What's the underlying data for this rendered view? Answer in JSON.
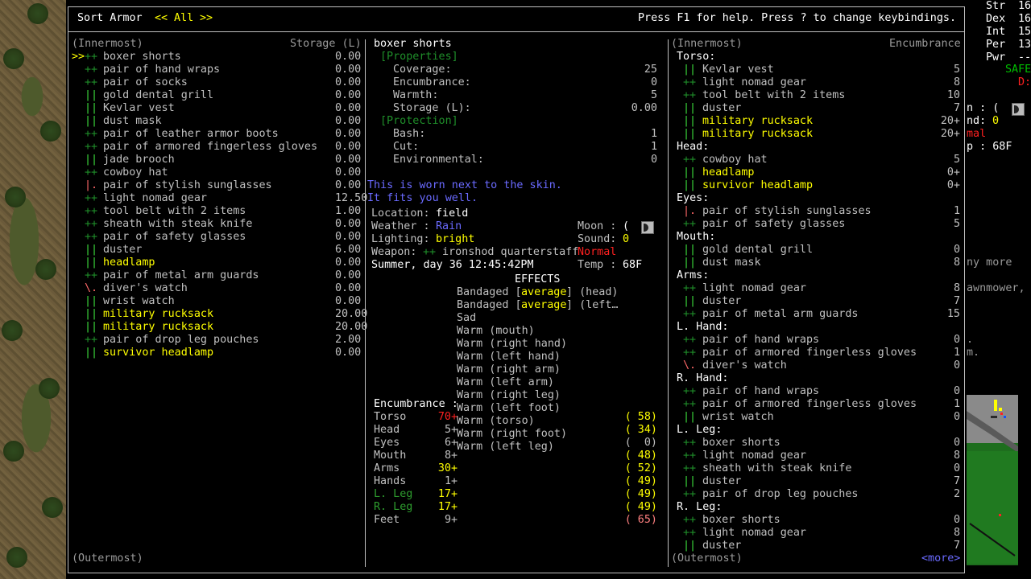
{
  "header": {
    "sort_label": "Sort Armor",
    "filter_left": "<<",
    "filter_value": "All",
    "filter_right": ">>",
    "help": "Press F1 for help. Press ? to change keybindings."
  },
  "left": {
    "col_title": "(Innermost)",
    "col_storage": "Storage (L)",
    "footer": "(Outermost)",
    "items": [
      {
        "mark": ">>",
        "sym": "++",
        "name": "boxer shorts",
        "val": "0.00"
      },
      {
        "mark": "",
        "sym": "++",
        "name": "pair of hand wraps",
        "val": "0.00"
      },
      {
        "mark": "",
        "sym": "++",
        "name": "pair of socks",
        "val": "0.00"
      },
      {
        "mark": "",
        "sym": "||",
        "name": "gold dental grill",
        "val": "0.00"
      },
      {
        "mark": "",
        "sym": "||",
        "name": "Kevlar vest",
        "val": "0.00"
      },
      {
        "mark": "",
        "sym": "||",
        "name": "dust mask",
        "val": "0.00"
      },
      {
        "mark": "",
        "sym": "++",
        "name": "pair of leather armor boots",
        "val": "0.00"
      },
      {
        "mark": "",
        "sym": "++",
        "name": "pair of armored fingerless gloves",
        "val": "0.00"
      },
      {
        "mark": "",
        "sym": "||",
        "name": "jade brooch",
        "val": "0.00"
      },
      {
        "mark": "",
        "sym": "++",
        "name": "cowboy hat",
        "val": "0.00"
      },
      {
        "mark": "",
        "sym": "|.",
        "name": "pair of stylish sunglasses",
        "val": "0.00"
      },
      {
        "mark": "",
        "sym": "++",
        "name": "light nomad gear",
        "val": "12.50"
      },
      {
        "mark": "",
        "sym": "++",
        "name": "tool belt with 2 items",
        "val": "1.00"
      },
      {
        "mark": "",
        "sym": "++",
        "name": "sheath with steak knife",
        "val": "0.00"
      },
      {
        "mark": "",
        "sym": "++",
        "name": "pair of safety glasses",
        "val": "0.00"
      },
      {
        "mark": "",
        "sym": "||",
        "name": "duster",
        "val": "6.00"
      },
      {
        "mark": "",
        "sym": "||",
        "name": "headlamp",
        "val": "0.00",
        "hl": true
      },
      {
        "mark": "",
        "sym": "++",
        "name": "pair of metal arm guards",
        "val": "0.00"
      },
      {
        "mark": "",
        "sym": "\\.",
        "name": "diver's watch",
        "val": "0.00"
      },
      {
        "mark": "",
        "sym": "||",
        "name": "wrist watch",
        "val": "0.00"
      },
      {
        "mark": "",
        "sym": "||",
        "name": "military rucksack",
        "val": "20.00",
        "hl": true
      },
      {
        "mark": "",
        "sym": "||",
        "name": "military rucksack",
        "val": "20.00",
        "hl": true
      },
      {
        "mark": "",
        "sym": "++",
        "name": "pair of drop leg pouches",
        "val": "2.00"
      },
      {
        "mark": "",
        "sym": "||",
        "name": "survivor headlamp",
        "val": "0.00",
        "hl": true
      }
    ]
  },
  "middle": {
    "item_title": "boxer shorts",
    "properties_header": "[Properties]",
    "properties": [
      {
        "label": "Coverage:",
        "value": "25"
      },
      {
        "label": "Encumbrance:",
        "value": "0"
      },
      {
        "label": "Warmth:",
        "value": "5"
      },
      {
        "label": "Storage (L):",
        "value": "0.00"
      }
    ],
    "protection_header": "[Protection]",
    "protection": [
      {
        "label": "Bash:",
        "value": "1"
      },
      {
        "label": "Cut:",
        "value": "1"
      },
      {
        "label": "Environmental:",
        "value": "0"
      }
    ],
    "note1": "This is worn next to the skin.",
    "note2": "It fits you well.",
    "status": {
      "location_label": "Location:",
      "location": "field",
      "weather_label": "Weather :",
      "weather": "Rain",
      "moon_label": "Moon :",
      "moon_icon": "moon-phase-icon",
      "lighting_label": "Lighting:",
      "lighting": "bright",
      "sound_label": "Sound:",
      "sound": "0",
      "weapon_label": "Weapon:",
      "weapon_sym": "++",
      "weapon": "ironshod quarterstaff",
      "weapon_state": "Normal",
      "date": "Summer, day 36 12:45:42PM",
      "temp_label": "Temp :",
      "temp": "68F"
    },
    "effects_header": "EFFECTS",
    "effects": [
      {
        "pre": "Bandaged [",
        "mid": "average",
        "post": "] (head)"
      },
      {
        "pre": "Bandaged [",
        "mid": "average",
        "post": "] (left…"
      },
      {
        "pre": "Sad",
        "mid": "",
        "post": ""
      },
      {
        "pre": "Warm (mouth)",
        "mid": "",
        "post": ""
      },
      {
        "pre": "Warm (right hand)",
        "mid": "",
        "post": ""
      },
      {
        "pre": "Warm (left hand)",
        "mid": "",
        "post": ""
      },
      {
        "pre": "Warm (right arm)",
        "mid": "",
        "post": ""
      },
      {
        "pre": "Warm (left arm)",
        "mid": "",
        "post": ""
      },
      {
        "pre": "Warm (right leg)",
        "mid": "",
        "post": ""
      },
      {
        "pre": "Warm (left foot)",
        "mid": "",
        "post": ""
      },
      {
        "pre": "Warm (torso)",
        "mid": "",
        "post": ""
      },
      {
        "pre": "Warm (right foot)",
        "mid": "",
        "post": ""
      },
      {
        "pre": "Warm (left leg)",
        "mid": "",
        "post": ""
      }
    ],
    "encumbrance_header": "Encumbrance :",
    "encumbrance": [
      {
        "part": "Torso",
        "a": "70",
        "b": "+16",
        "warmth": "( 58)",
        "ca": "r",
        "cb": "r",
        "cw": "y"
      },
      {
        "part": "Head",
        "a": "5",
        "b": "+2",
        "warmth": "( 34)",
        "ca": "g",
        "cb": "g",
        "cw": "y"
      },
      {
        "part": "Eyes",
        "a": "6",
        "b": "+0",
        "warmth": "(  0)",
        "ca": "g",
        "cb": "g",
        "cw": "g"
      },
      {
        "part": "Mouth",
        "a": "8",
        "b": "+0",
        "warmth": "( 48)",
        "ca": "g",
        "cb": "g",
        "cw": "y"
      },
      {
        "part": "Arms",
        "a": "30",
        "b": "+0",
        "warmth": "( 52)",
        "ca": "y",
        "cb": "y",
        "cw": "y"
      },
      {
        "part": "Hands",
        "a": "1",
        "b": "+0",
        "warmth": "( 49)",
        "ca": "g",
        "cb": "g",
        "cw": "y"
      },
      {
        "part": "L. Leg",
        "a": "17",
        "b": "+0",
        "warmth": "( 49)",
        "ca": "y",
        "cb": "y",
        "cw": "y",
        "pc": "tg"
      },
      {
        "part": "R. Leg",
        "a": "17",
        "b": "+0",
        "warmth": "( 49)",
        "ca": "y",
        "cb": "y",
        "cw": "y",
        "pc": "tg"
      },
      {
        "part": "Feet",
        "a": "9",
        "b": "+0",
        "warmth": "( 65)",
        "ca": "g",
        "cb": "g",
        "cw": "pk"
      }
    ]
  },
  "right": {
    "col_title": "(Innermost)",
    "col_enc": "Encumbrance",
    "footer": "(Outermost)",
    "more": "<more>",
    "rows": [
      {
        "t": "h",
        "name": "Torso:"
      },
      {
        "t": "i",
        "sym": "||",
        "name": "Kevlar vest",
        "val": "5"
      },
      {
        "t": "i",
        "sym": "++",
        "name": "light nomad gear",
        "val": "8"
      },
      {
        "t": "i",
        "sym": "++",
        "name": "tool belt with 2 items",
        "val": "10"
      },
      {
        "t": "i",
        "sym": "||",
        "name": "duster",
        "val": "7"
      },
      {
        "t": "i",
        "sym": "||",
        "name": "military rucksack",
        "val": "20+",
        "hl": true
      },
      {
        "t": "i",
        "sym": "||",
        "name": "military rucksack",
        "val": "20+",
        "hl": true
      },
      {
        "t": "h",
        "name": "Head:"
      },
      {
        "t": "i",
        "sym": "++",
        "name": "cowboy hat",
        "val": "5"
      },
      {
        "t": "i",
        "sym": "||",
        "name": "headlamp",
        "val": "0+",
        "hl": true
      },
      {
        "t": "i",
        "sym": "||",
        "name": "survivor headlamp",
        "val": "0+",
        "hl": true
      },
      {
        "t": "h",
        "name": "Eyes:"
      },
      {
        "t": "i",
        "sym": "|.",
        "name": "pair of stylish sunglasses",
        "val": "1"
      },
      {
        "t": "i",
        "sym": "++",
        "name": "pair of safety glasses",
        "val": "5"
      },
      {
        "t": "h",
        "name": "Mouth:"
      },
      {
        "t": "i",
        "sym": "||",
        "name": "gold dental grill",
        "val": "0"
      },
      {
        "t": "i",
        "sym": "||",
        "name": "dust mask",
        "val": "8"
      },
      {
        "t": "h",
        "name": "Arms:"
      },
      {
        "t": "i",
        "sym": "++",
        "name": "light nomad gear",
        "val": "8"
      },
      {
        "t": "i",
        "sym": "||",
        "name": "duster",
        "val": "7"
      },
      {
        "t": "i",
        "sym": "++",
        "name": "pair of metal arm guards",
        "val": "15"
      },
      {
        "t": "h",
        "name": "L. Hand:"
      },
      {
        "t": "i",
        "sym": "++",
        "name": "pair of hand wraps",
        "val": "0"
      },
      {
        "t": "i",
        "sym": "++",
        "name": "pair of armored fingerless gloves",
        "val": "1"
      },
      {
        "t": "i",
        "sym": "\\.",
        "name": "diver's watch",
        "val": "0"
      },
      {
        "t": "h",
        "name": "R. Hand:"
      },
      {
        "t": "i",
        "sym": "++",
        "name": "pair of hand wraps",
        "val": "0"
      },
      {
        "t": "i",
        "sym": "++",
        "name": "pair of armored fingerless gloves",
        "val": "1"
      },
      {
        "t": "i",
        "sym": "||",
        "name": "wrist watch",
        "val": "0"
      },
      {
        "t": "h",
        "name": "L. Leg:"
      },
      {
        "t": "i",
        "sym": "++",
        "name": "boxer shorts",
        "val": "0"
      },
      {
        "t": "i",
        "sym": "++",
        "name": "light nomad gear",
        "val": "8"
      },
      {
        "t": "i",
        "sym": "++",
        "name": "sheath with steak knife",
        "val": "0"
      },
      {
        "t": "i",
        "sym": "||",
        "name": "duster",
        "val": "7"
      },
      {
        "t": "i",
        "sym": "++",
        "name": "pair of drop leg pouches",
        "val": "2"
      },
      {
        "t": "h",
        "name": "R. Leg:"
      },
      {
        "t": "i",
        "sym": "++",
        "name": "boxer shorts",
        "val": "0"
      },
      {
        "t": "i",
        "sym": "++",
        "name": "light nomad gear",
        "val": "8"
      },
      {
        "t": "i",
        "sym": "||",
        "name": "duster",
        "val": "7"
      }
    ]
  },
  "sidebar": {
    "stats": [
      {
        "label": "Str",
        "val": "16"
      },
      {
        "label": "Dex",
        "val": "16"
      },
      {
        "label": "Int",
        "val": "15"
      },
      {
        "label": "Per",
        "val": "13"
      },
      {
        "label": "Pwr",
        "val": "--"
      }
    ],
    "safe": "SAFE",
    "d": "D:",
    "moon_frag": "n : (",
    "sound_frag": "nd:",
    "sound_val": "0",
    "mal": "mal",
    "temp_frag": "p : 68F",
    "msg1": "ny more",
    "msg2": "awnmower,",
    "msg3": ".",
    "msg4": "m."
  },
  "colors": {
    "highlight": "#ffff00",
    "green": "#00c000",
    "red": "#ff2020",
    "blue": "#6a6aff"
  }
}
